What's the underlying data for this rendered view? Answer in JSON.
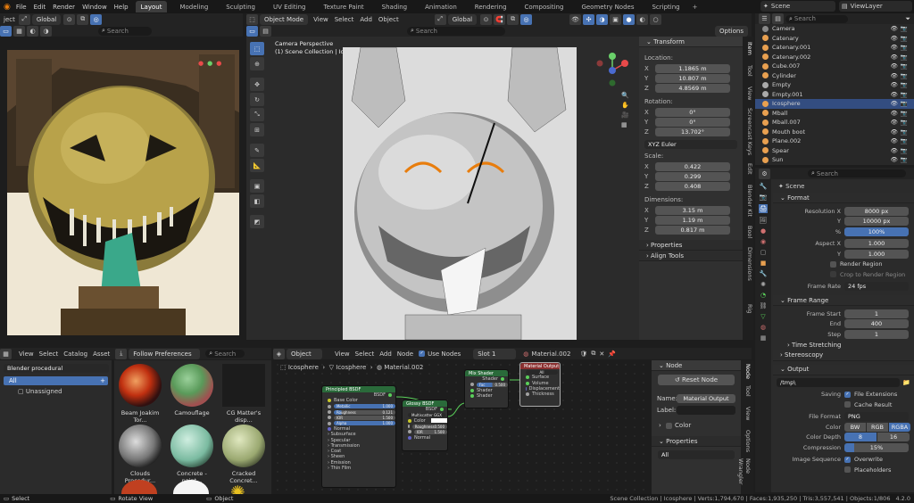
{
  "menu": {
    "items": [
      "File",
      "Edit",
      "Render",
      "Window",
      "Help"
    ],
    "workspaces": [
      "Layout",
      "Modeling",
      "Sculpting",
      "UV Editing",
      "Texture Paint",
      "Shading",
      "Animation",
      "Rendering",
      "Compositing",
      "Geometry Nodes",
      "Scripting"
    ],
    "active_workspace": "Layout",
    "scene": "Scene",
    "view_layer": "ViewLayer"
  },
  "left_view": {
    "header": [
      "ject",
      "Global",
      "Search"
    ]
  },
  "viewport": {
    "mode": "Object Mode",
    "menu": [
      "View",
      "Select",
      "Add",
      "Object"
    ],
    "transform_orient": "Global",
    "options": "Options",
    "camera_title": "Camera Perspective",
    "collection_line": "(1) Scene Collection | Icosphere",
    "search": "Search"
  },
  "n_panel": {
    "tabs": [
      "Item",
      "Tool",
      "View",
      "Screencast Keys",
      "Edit",
      "Blender Kit",
      "Bool",
      "Dimensions",
      "Rig"
    ],
    "transform": "Transform",
    "location": "Location:",
    "loc": {
      "x": "1.1865 m",
      "y": "10.807 m",
      "z": "4.8569 m"
    },
    "rotation": "Rotation:",
    "rot": {
      "x": "0°",
      "y": "0°",
      "z": "13.702°"
    },
    "rot_mode": "XYZ Euler",
    "scale": "Scale:",
    "scl": {
      "x": "0.422",
      "y": "0.299",
      "z": "0.408"
    },
    "dimensions": "Dimensions:",
    "dim": {
      "x": "3.15 m",
      "y": "1.19 m",
      "z": "0.817 m"
    },
    "properties": "Properties",
    "align_tools": "Align Tools"
  },
  "outliner": {
    "search": "Search",
    "rows": [
      {
        "name": "Camera"
      },
      {
        "name": "Catenary"
      },
      {
        "name": "Catenary.001"
      },
      {
        "name": "Catenary.002"
      },
      {
        "name": "Cube.007"
      },
      {
        "name": "Cylinder"
      },
      {
        "name": "Empty"
      },
      {
        "name": "Empty.001"
      },
      {
        "name": "Icosphere"
      },
      {
        "name": "Mball"
      },
      {
        "name": "Mball.007"
      },
      {
        "name": "Mouth boot"
      },
      {
        "name": "Plane.002"
      },
      {
        "name": "Spear"
      },
      {
        "name": "Sun"
      }
    ]
  },
  "properties": {
    "search": "Search",
    "scene": "Scene",
    "format": "Format",
    "res_x_label": "Resolution X",
    "res_x": "8000 px",
    "res_y_label": "Y",
    "res_y": "10000 px",
    "pct_label": "%",
    "pct": "100%",
    "aspect_x_label": "Aspect X",
    "aspect_x": "1.000",
    "aspect_y_label": "Y",
    "aspect_y": "1.000",
    "render_region": "Render Region",
    "crop_region": "Crop to Render Region",
    "frame_rate_label": "Frame Rate",
    "frame_rate": "24 fps",
    "frame_range": "Frame Range",
    "frame_start_label": "Frame Start",
    "frame_start": "1",
    "end_label": "End",
    "end": "400",
    "step_label": "Step",
    "step": "1",
    "time_stretching": "Time Stretching",
    "stereoscopy": "Stereoscopy",
    "output": "Output",
    "output_path": "/tmp\\",
    "saving_label": "Saving",
    "file_extensions": "File Extensions",
    "cache_result": "Cache Result",
    "file_format_label": "File Format",
    "file_format": "PNG",
    "color_label": "Color",
    "color_opts": [
      "BW",
      "RGB",
      "RGBA"
    ],
    "color_depth_label": "Color Depth",
    "depth_opts": [
      "8",
      "16"
    ],
    "compression_label": "Compression",
    "compression": "15%",
    "image_sequence_label": "Image Sequence",
    "overwrite": "Overwrite",
    "placeholders": "Placeholders"
  },
  "assets": {
    "menu": [
      "View",
      "Select",
      "Catalog",
      "Asset"
    ],
    "library": "Blender procedural",
    "follow": "Follow Preferences",
    "search": "Search",
    "catalog_all": "All",
    "unassigned": "Unassigned",
    "items": [
      {
        "name": "Beam Joakim Tor..."
      },
      {
        "name": "Camouflage"
      },
      {
        "name": "CG Matter's disp..."
      },
      {
        "name": "Clouds Procedur..."
      },
      {
        "name": "Concrete - paint..."
      },
      {
        "name": "Cracked Concret..."
      }
    ]
  },
  "node_editor": {
    "object": "Object",
    "menu": [
      "View",
      "Select",
      "Add",
      "Node"
    ],
    "use_nodes": "Use Nodes",
    "slot": "Slot 1",
    "material": "Material.002",
    "breadcrumb": [
      "Icosphere",
      "Icosphere",
      "Material.002"
    ],
    "nodes": {
      "principled": "Principled BSDF",
      "principled_rows": [
        "BSDF",
        "Base Color",
        "Metallic",
        "Roughness",
        "IOR",
        "Alpha",
        "Normal",
        "Subsurface",
        "Specular",
        "Transmission",
        "Coat",
        "Sheen",
        "Emission",
        "Thin Film"
      ],
      "gloss": "Glossy BSDF",
      "gloss_rows": [
        "BSDF",
        "Multiscatter GGX",
        "Color",
        "Roughness",
        "IOR",
        "Normal"
      ],
      "mix": "Mix Shader",
      "mix_rows": [
        "Shader",
        "Fac",
        "Shader",
        "Shader"
      ],
      "output": "Material Output",
      "output_rows": [
        "All",
        "Surface",
        "Volume",
        "Displacement",
        "Thickness"
      ]
    },
    "values": {
      "metallic": "1.000",
      "roughness": "0.121",
      "ior": "1.500",
      "alpha": "1.000",
      "fac": "0.500",
      "g_rough": "0.500",
      "g_ior": "1.500"
    }
  },
  "node_panel": {
    "tabs": [
      "Node",
      "Tool",
      "View",
      "Options",
      "Node Wrangler"
    ],
    "node": "Node",
    "reset": "Reset Node",
    "name_label": "Name:",
    "name": "Material Output",
    "label_label": "Label:",
    "color": "Color",
    "properties": "Properties",
    "target": "All"
  },
  "status": {
    "select": "Select",
    "rotate": "Rotate View",
    "object": "Object",
    "info": "Scene Collection | Icosphere | Verts:1,794,670 | Faces:1,935,250 | Tris:3,557,541 | Objects:1/806",
    "version": "4.2.0"
  },
  "colors": {
    "accent": "#4772b3",
    "selected_row": "#334d80"
  }
}
